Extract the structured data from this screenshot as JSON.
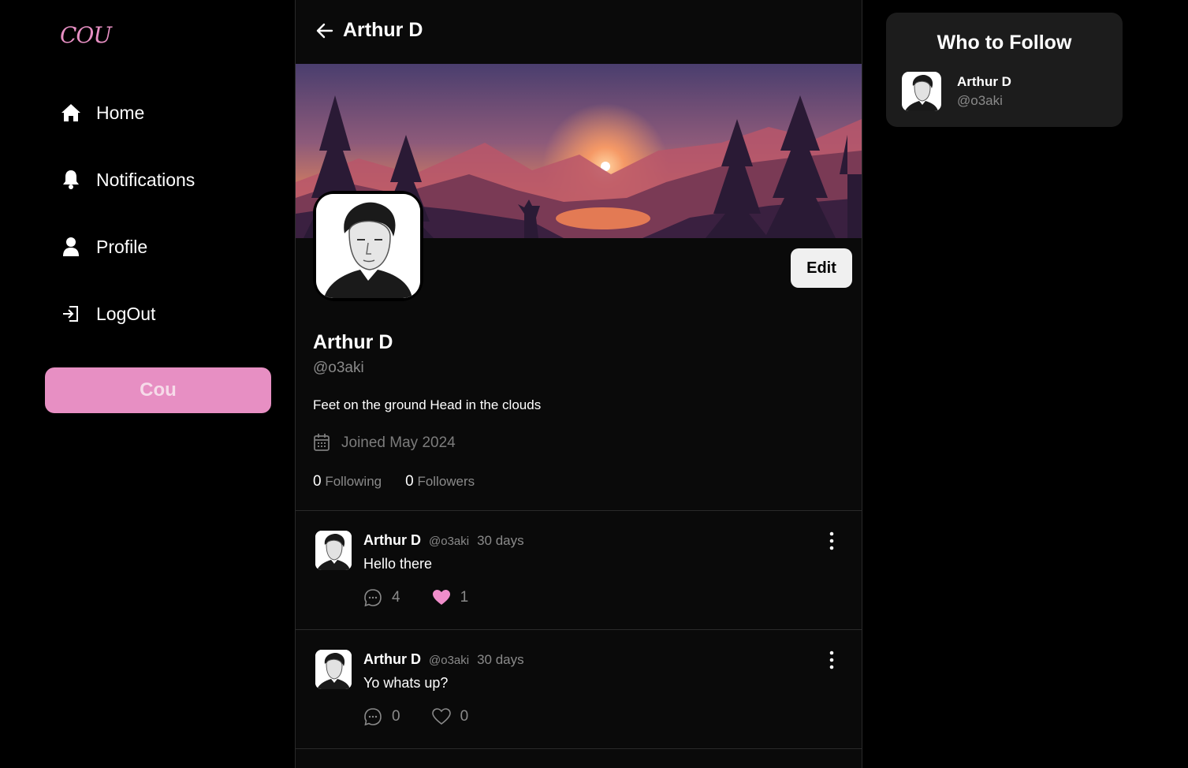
{
  "app": {
    "logo": "COU",
    "brand_color": "#e78fc3"
  },
  "sidebar": {
    "items": [
      {
        "label": "Home",
        "icon": "home-icon"
      },
      {
        "label": "Notifications",
        "icon": "bell-icon"
      },
      {
        "label": "Profile",
        "icon": "user-icon"
      },
      {
        "label": "LogOut",
        "icon": "logout-icon"
      }
    ],
    "cou_button": "Cou"
  },
  "header": {
    "title": "Arthur D",
    "back_icon": "arrow-left-icon"
  },
  "profile": {
    "name": "Arthur D",
    "handle": "@o3aki",
    "bio": "Feet on the ground Head in the clouds",
    "joined": "Joined May 2024",
    "edit_label": "Edit",
    "following_count": "0",
    "following_label": "Following",
    "followers_count": "0",
    "followers_label": "Followers"
  },
  "posts": [
    {
      "name": "Arthur D",
      "handle": "@o3aki",
      "time": "30 days",
      "text": "Hello there",
      "comments": "4",
      "likes": "1",
      "liked": true
    },
    {
      "name": "Arthur D",
      "handle": "@o3aki",
      "time": "30 days",
      "text": "Yo whats up?",
      "comments": "0",
      "likes": "0",
      "liked": false
    }
  ],
  "who_to_follow": {
    "title": "Who to Follow",
    "users": [
      {
        "name": "Arthur D",
        "handle": "@o3aki"
      }
    ]
  }
}
